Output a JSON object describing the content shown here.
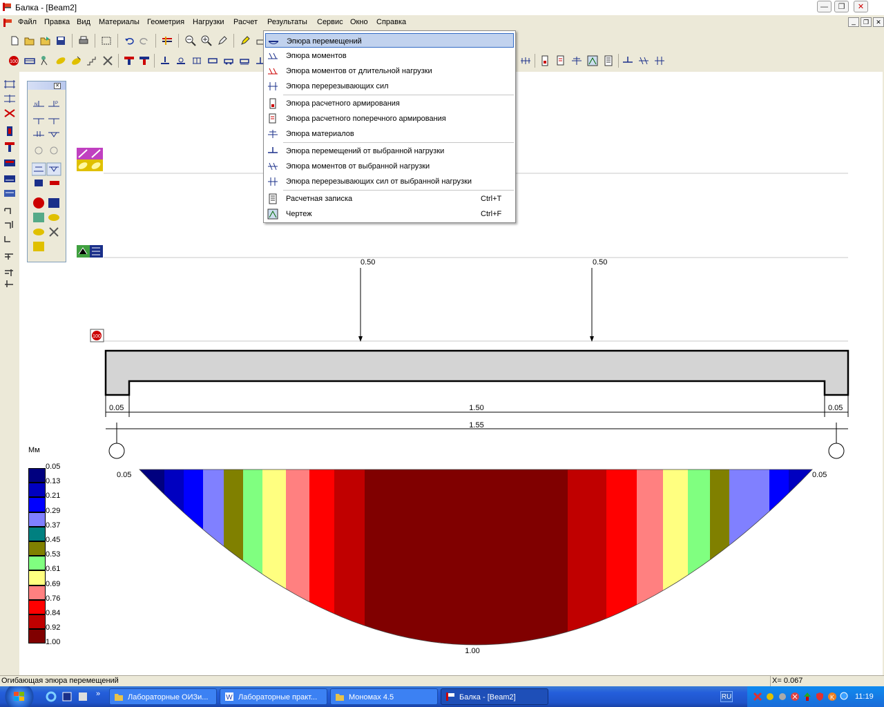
{
  "window": {
    "title": "Балка - [Beam2]"
  },
  "menu": {
    "items": [
      "Файл",
      "Правка",
      "Вид",
      "Материалы",
      "Геометрия",
      "Нагрузки",
      "Расчет",
      "Результаты",
      "Сервис",
      "Окно",
      "Справка"
    ],
    "active": "Результаты"
  },
  "dropdown": {
    "items": [
      {
        "label": "Эпюра перемещений",
        "shortcut": "",
        "icon": "displacement-diagram-icon",
        "highlighted": true
      },
      {
        "label": "Эпюра моментов",
        "shortcut": "",
        "icon": "moment-diagram-icon"
      },
      {
        "label": "Эпюра моментов от длительной нагрузки",
        "shortcut": "",
        "icon": "long-term-moment-icon"
      },
      {
        "label": "Эпюра перерезывающих сил",
        "shortcut": "",
        "icon": "shear-diagram-icon"
      },
      {
        "label": "Эпюра расчетного армирования",
        "shortcut": "",
        "icon": "reinforcement-icon"
      },
      {
        "label": "Эпюра расчетного поперечного армирования",
        "shortcut": "",
        "icon": "transverse-reinforcement-icon"
      },
      {
        "label": "Эпюра материалов",
        "shortcut": "",
        "icon": "materials-diagram-icon"
      },
      {
        "label": "Эпюра перемещений от выбранной нагрузки",
        "shortcut": "",
        "icon": "selected-load-displacement-icon"
      },
      {
        "label": "Эпюра моментов от выбранной нагрузки",
        "shortcut": "",
        "icon": "selected-load-moment-icon"
      },
      {
        "label": "Эпюра перерезывающих сил от выбранной нагрузки",
        "shortcut": "",
        "icon": "selected-load-shear-icon"
      },
      {
        "label": "Расчетная записка",
        "shortcut": "Ctrl+T",
        "icon": "report-icon"
      },
      {
        "label": "Чертеж",
        "shortcut": "Ctrl+F",
        "icon": "drawing-icon"
      }
    ]
  },
  "beam": {
    "loads": [
      "0.50",
      "0.50"
    ],
    "dims": {
      "left": "0.05",
      "span": "1.50",
      "right": "0.05",
      "total": "1.55"
    }
  },
  "diagram": {
    "end_left": "0.05",
    "end_right": "0.05",
    "max": "1.00"
  },
  "legend": {
    "unit": "Мм",
    "levels": [
      "0.05",
      "0.13",
      "0.21",
      "0.29",
      "0.37",
      "0.45",
      "0.53",
      "0.61",
      "0.69",
      "0.76",
      "0.84",
      "0.92",
      "1.00"
    ],
    "colors": [
      "#00007f",
      "#0000c0",
      "#0000ff",
      "#8080ff",
      "#008080",
      "#808000",
      "#80ff80",
      "#ffff80",
      "#ff8080",
      "#ff0000",
      "#c00000",
      "#800000"
    ]
  },
  "status": {
    "text": "Огибающая эпюра перемещений",
    "coord": "X= 0.067"
  },
  "taskbar": {
    "tasks": [
      "Лабораторные ОИЗи...",
      "Лабораторные практ...",
      "Мономах 4.5",
      "Балка - [Beam2]"
    ],
    "lang": "RU",
    "time": "11:19"
  }
}
